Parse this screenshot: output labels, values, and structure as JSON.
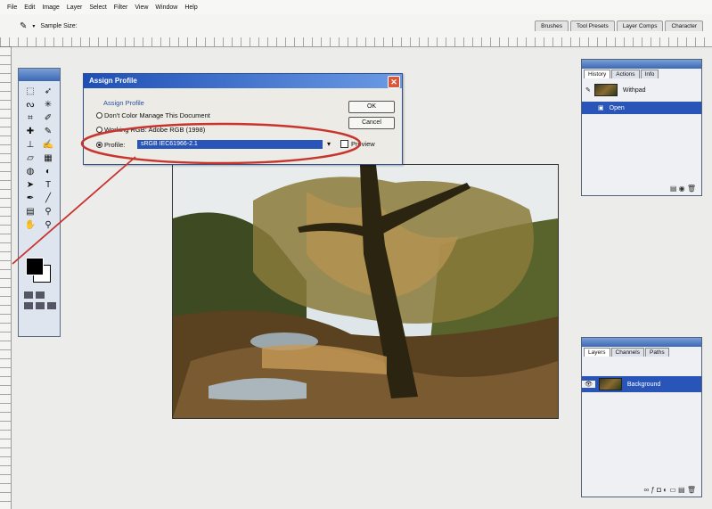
{
  "menu": [
    "File",
    "Edit",
    "Image",
    "Layer",
    "Select",
    "Filter",
    "View",
    "Window",
    "Help"
  ],
  "options_bar": {
    "sample_size_label": "Sample Size:"
  },
  "palette_well": [
    "Brushes",
    "Tool Presets",
    "Layer Comps",
    "Character"
  ],
  "dialog": {
    "title": "Assign Profile",
    "legend": "Assign Profile",
    "option_dont_manage": "Don't Color Manage This Document",
    "option_working": "Working RGB: Adobe RGB (1998)",
    "option_profile": "Profile:",
    "profile_value": "sRGB IEC61966-2.1",
    "ok_label": "OK",
    "cancel_label": "Cancel",
    "preview_label": "Preview",
    "accent": "#2a55b8"
  },
  "history_panel": {
    "tabs": [
      "History",
      "Actions",
      "Info"
    ],
    "snapshot_label": "Withpad",
    "state_label": "Open"
  },
  "layers_panel": {
    "tabs": [
      "Layers",
      "Channels",
      "Paths"
    ],
    "layer_label": "Background"
  },
  "annotation": {
    "circle_color": "#c8342e"
  }
}
